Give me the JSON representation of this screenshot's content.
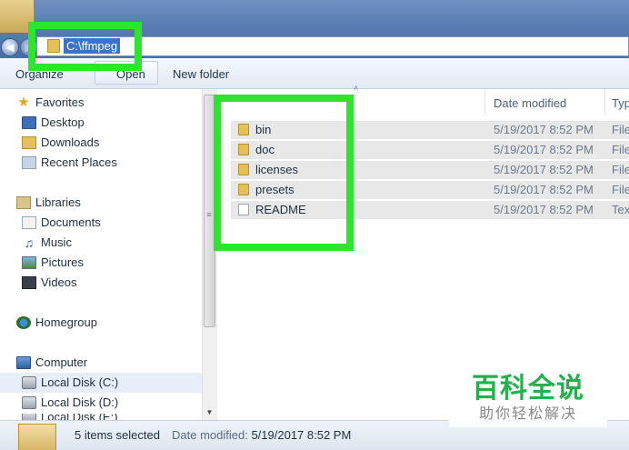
{
  "address": {
    "path": "C:\\ffmpeg",
    "folder_icon": "folder-icon"
  },
  "toolbar": {
    "organize_label": "Organize",
    "open_label": "Open",
    "new_folder_label": "New folder"
  },
  "sidebar": {
    "favorites": {
      "label": "Favorites",
      "icon": "star-icon",
      "items": [
        {
          "label": "Desktop",
          "icon": "desktop-icon"
        },
        {
          "label": "Downloads",
          "icon": "downloads-icon"
        },
        {
          "label": "Recent Places",
          "icon": "recent-places-icon"
        }
      ]
    },
    "libraries": {
      "label": "Libraries",
      "icon": "libraries-icon",
      "items": [
        {
          "label": "Documents",
          "icon": "documents-icon"
        },
        {
          "label": "Music",
          "icon": "music-icon"
        },
        {
          "label": "Pictures",
          "icon": "pictures-icon"
        },
        {
          "label": "Videos",
          "icon": "videos-icon"
        }
      ]
    },
    "homegroup": {
      "label": "Homegroup",
      "icon": "homegroup-icon"
    },
    "computer": {
      "label": "Computer",
      "icon": "computer-icon",
      "items": [
        {
          "label": "Local Disk (C:)",
          "icon": "disk-icon"
        },
        {
          "label": "Local Disk (D:)",
          "icon": "disk-icon"
        },
        {
          "label": "Local Disk (E:)",
          "icon": "disk-icon"
        }
      ]
    }
  },
  "filelist": {
    "columns": {
      "date_modified": "Date modified",
      "type": "Typ"
    },
    "rows": [
      {
        "name": "bin",
        "date": "5/19/2017 8:52 PM",
        "type": "File",
        "icon": "folder-icon"
      },
      {
        "name": "doc",
        "date": "5/19/2017 8:52 PM",
        "type": "File",
        "icon": "folder-icon"
      },
      {
        "name": "licenses",
        "date": "5/19/2017 8:52 PM",
        "type": "File",
        "icon": "folder-icon"
      },
      {
        "name": "presets",
        "date": "5/19/2017 8:52 PM",
        "type": "File",
        "icon": "folder-icon"
      },
      {
        "name": "README",
        "date": "5/19/2017 8:52 PM",
        "type": "Tex",
        "icon": "file-icon"
      }
    ]
  },
  "details": {
    "count": "5 items selected",
    "date_label": "Date modified:",
    "date_value": "5/19/2017 8:52 PM"
  },
  "watermark": {
    "title": "百科全说",
    "subtitle": "助你轻松解决"
  },
  "colors": {
    "highlight": "#2ee52e",
    "selection": "#3a73c8",
    "watermark_green": "#22b14c"
  }
}
